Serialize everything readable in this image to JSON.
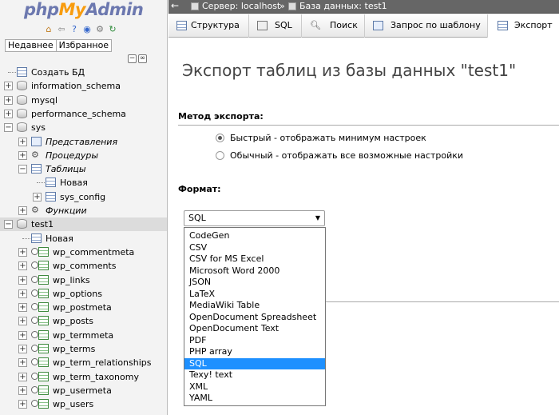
{
  "nav": {
    "logo_php": "php",
    "logo_my": "My",
    "logo_admin": "Admin",
    "quick_icons": [
      "home-icon",
      "exit-icon",
      "help-icon",
      "docs-icon",
      "settings-icon",
      "reload-icon"
    ],
    "tabs": [
      "Недавнее",
      "Избранное"
    ],
    "tree": [
      {
        "label": "Создать БД",
        "level": 0,
        "kind": "new",
        "expander": "",
        "italic": false
      },
      {
        "label": "information_schema",
        "level": 0,
        "kind": "db",
        "expander": "+",
        "italic": false
      },
      {
        "label": "mysql",
        "level": 0,
        "kind": "db",
        "expander": "+",
        "italic": false
      },
      {
        "label": "performance_schema",
        "level": 0,
        "kind": "db",
        "expander": "+",
        "italic": false
      },
      {
        "label": "sys",
        "level": 0,
        "kind": "db",
        "expander": "−",
        "italic": false
      },
      {
        "label": "Представления",
        "level": 1,
        "kind": "view",
        "expander": "+",
        "italic": true
      },
      {
        "label": "Процедуры",
        "level": 1,
        "kind": "func",
        "expander": "+",
        "italic": true
      },
      {
        "label": "Таблицы",
        "level": 1,
        "kind": "table",
        "expander": "−",
        "italic": true
      },
      {
        "label": "Новая",
        "level": 2,
        "kind": "new",
        "expander": "",
        "italic": false
      },
      {
        "label": "sys_config",
        "level": 2,
        "kind": "table",
        "expander": "+",
        "italic": false
      },
      {
        "label": "Функции",
        "level": 1,
        "kind": "func",
        "expander": "+",
        "italic": true
      },
      {
        "label": "test1",
        "level": 0,
        "kind": "db",
        "expander": "−",
        "italic": false,
        "selected": true
      },
      {
        "label": "Новая",
        "level": 1,
        "kind": "new",
        "expander": "",
        "italic": false
      },
      {
        "label": "wp_commentmeta",
        "level": 1,
        "kind": "tblcombo",
        "expander": "+",
        "italic": false
      },
      {
        "label": "wp_comments",
        "level": 1,
        "kind": "tblcombo",
        "expander": "+",
        "italic": false
      },
      {
        "label": "wp_links",
        "level": 1,
        "kind": "tblcombo",
        "expander": "+",
        "italic": false
      },
      {
        "label": "wp_options",
        "level": 1,
        "kind": "tblcombo",
        "expander": "+",
        "italic": false
      },
      {
        "label": "wp_postmeta",
        "level": 1,
        "kind": "tblcombo",
        "expander": "+",
        "italic": false
      },
      {
        "label": "wp_posts",
        "level": 1,
        "kind": "tblcombo",
        "expander": "+",
        "italic": false
      },
      {
        "label": "wp_termmeta",
        "level": 1,
        "kind": "tblcombo",
        "expander": "+",
        "italic": false
      },
      {
        "label": "wp_terms",
        "level": 1,
        "kind": "tblcombo",
        "expander": "+",
        "italic": false
      },
      {
        "label": "wp_term_relationships",
        "level": 1,
        "kind": "tblcombo",
        "expander": "+",
        "italic": false
      },
      {
        "label": "wp_term_taxonomy",
        "level": 1,
        "kind": "tblcombo",
        "expander": "+",
        "italic": false
      },
      {
        "label": "wp_usermeta",
        "level": 1,
        "kind": "tblcombo",
        "expander": "+",
        "italic": false
      },
      {
        "label": "wp_users",
        "level": 1,
        "kind": "tblcombo",
        "expander": "+",
        "italic": false
      }
    ]
  },
  "breadcrumb": {
    "server": "Сервер: localhost",
    "database": "База данных: test1"
  },
  "tabs": [
    {
      "label": "Структура",
      "icon": "structure-icon",
      "active": false
    },
    {
      "label": "SQL",
      "icon": "sql-icon",
      "active": false
    },
    {
      "label": "Поиск",
      "icon": "search-icon",
      "active": false
    },
    {
      "label": "Запрос по шаблону",
      "icon": "query-icon",
      "active": false
    },
    {
      "label": "Экспорт",
      "icon": "export-icon",
      "active": true
    }
  ],
  "main": {
    "title": "Экспорт таблиц из базы данных \"test1\"",
    "method_header": "Метод экспорта:",
    "method_options": [
      {
        "label": "Быстрый - отображать минимум настроек",
        "checked": true
      },
      {
        "label": "Обычный - отображать все возможные настройки",
        "checked": false
      }
    ],
    "format_header": "Формат:",
    "format_selected": "SQL",
    "format_options": [
      "CodeGen",
      "CSV",
      "CSV for MS Excel",
      "Microsoft Word 2000",
      "JSON",
      "LaTeX",
      "MediaWiki Table",
      "OpenDocument Spreadsheet",
      "OpenDocument Text",
      "PDF",
      "PHP array",
      "SQL",
      "Texy! text",
      "XML",
      "YAML"
    ],
    "format_highlighted": "SQL"
  },
  "colors": {
    "logo_blue": "#6c78af",
    "logo_orange": "#f89c0e",
    "highlight": "#1e90ff",
    "topbar": "#666666"
  }
}
